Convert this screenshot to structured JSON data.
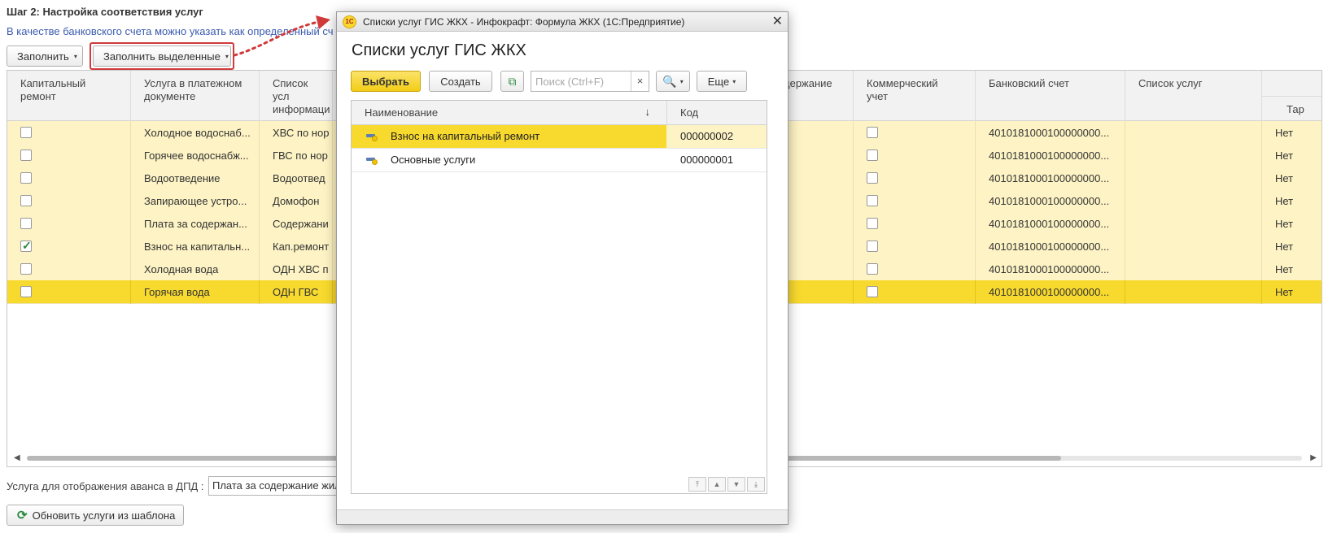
{
  "page": {
    "step_title": "Шаг 2: Настройка соответствия услуг",
    "hint": "В качестве банковского счета можно указать как определенный сч",
    "fill_button": "Заполнить",
    "fill_selected_button": "Заполнить выделенные"
  },
  "grid": {
    "columns": [
      "Капитальный ремонт",
      "Услуга в платежном документе",
      "Список усл информаци",
      "держание",
      "Коммерческий учет",
      "Банковский счет",
      "Список услуг",
      "",
      "Тар"
    ],
    "rows": [
      {
        "capital": false,
        "service": "Холодное водоснаб...",
        "list_info": "ХВС по нор",
        "commercial": false,
        "account": "4010181000100000000...",
        "list": "",
        "tariff": "Нет",
        "selected": false
      },
      {
        "capital": false,
        "service": "Горячее водоснабж...",
        "list_info": "ГВС по нор",
        "commercial": false,
        "account": "4010181000100000000...",
        "list": "",
        "tariff": "Нет",
        "selected": false
      },
      {
        "capital": false,
        "service": "Водоотведение",
        "list_info": "Водоотвед",
        "commercial": false,
        "account": "4010181000100000000...",
        "list": "",
        "tariff": "Нет",
        "selected": false
      },
      {
        "capital": false,
        "service": "Запирающее устро...",
        "list_info": "Домофон",
        "commercial": false,
        "account": "4010181000100000000...",
        "list": "",
        "tariff": "Нет",
        "selected": false
      },
      {
        "capital": false,
        "service": "Плата за содержан...",
        "list_info": "Содержани",
        "commercial": false,
        "account": "4010181000100000000...",
        "list": "",
        "tariff": "Нет",
        "selected": false
      },
      {
        "capital": true,
        "service": "Взнос на капитальн...",
        "list_info": "Кап.ремонт",
        "commercial": false,
        "account": "4010181000100000000...",
        "list": "",
        "tariff": "Нет",
        "selected": false
      },
      {
        "capital": false,
        "service": "Холодная вода",
        "list_info": "ОДН ХВС п",
        "commercial": false,
        "account": "4010181000100000000...",
        "list": "",
        "tariff": "Нет",
        "selected": false
      },
      {
        "capital": false,
        "service": "Горячая вода",
        "list_info": "ОДН ГВС",
        "commercial": false,
        "account": "4010181000100000000...",
        "list": "",
        "tariff": "Нет",
        "selected": true
      }
    ],
    "scroll_fraction": 0.81
  },
  "footer": {
    "advance_label": "Услуга для отображения аванса в ДПД :",
    "advance_value": "Плата за содержание жил",
    "refresh_button": "Обновить услуги из шаблона"
  },
  "dialog": {
    "window_title": "Списки услуг ГИС ЖКХ - Инфокрафт: Формула ЖКХ  (1С:Предприятие)",
    "logo_text": "1С",
    "heading": "Списки услуг ГИС ЖКХ",
    "select_button": "Выбрать",
    "create_button": "Создать",
    "search_placeholder": "Поиск (Ctrl+F)",
    "search_clear": "×",
    "more_button": "Еще",
    "col_name": "Наименование",
    "col_code": "Код",
    "sort_arrow": "↓",
    "items": [
      {
        "name": "Взнос на капитальный ремонт",
        "code": "000000002",
        "current": true
      },
      {
        "name": "Основные услуги",
        "code": "000000001",
        "current": false
      }
    ]
  },
  "icons": {
    "caret": "▾",
    "close": "✕",
    "search": "🔍",
    "refresh": "⟳",
    "copy": "⧉",
    "checkmark": "✓",
    "nav": [
      "⤒",
      "▲",
      "▼",
      "⤓"
    ]
  },
  "colors": {
    "row_bg": "#fdf3c4",
    "row_selected": "#f8d92e",
    "hint_text": "#3b5bb0",
    "highlight_frame": "#d03a3a"
  }
}
